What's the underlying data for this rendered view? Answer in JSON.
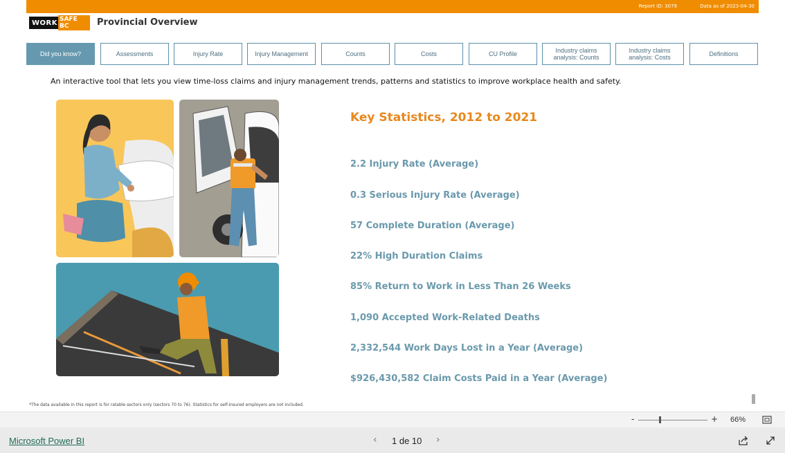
{
  "header": {
    "report_id": "Report ID: 3079",
    "data_as_of": "Data as of 2023-04-30",
    "logo_work": "WORK",
    "logo_safebc": "SAFE BC",
    "title": "Provincial Overview"
  },
  "tabs": [
    {
      "label": "Did you know?",
      "active": true
    },
    {
      "label": "Assessments"
    },
    {
      "label": "Injury Rate"
    },
    {
      "label": "Injury Management"
    },
    {
      "label": "Counts"
    },
    {
      "label": "Costs"
    },
    {
      "label": "CU Profile"
    },
    {
      "label": "Industry claims analysis: Counts"
    },
    {
      "label": "Industry claims analysis: Costs"
    },
    {
      "label": "Definitions"
    }
  ],
  "intro": "An interactive tool that lets you view time-loss claims and injury management trends, patterns and statistics to improve workplace health and safety.",
  "key_stats": {
    "title": "Key Statistics, 2012 to 2021",
    "items": [
      "2.2 Injury Rate (Average)",
      "0.3 Serious Injury Rate (Average)",
      "57 Complete Duration (Average)",
      "22% High Duration Claims",
      "85% Return to Work in Less Than 26 Weeks",
      "1,090 Accepted Work-Related Deaths",
      "2,332,544 Work Days Lost in a Year (Average)",
      "$926,430,582 Claim Costs Paid in a Year (Average)"
    ]
  },
  "footnote": "*The data available in this report is for ratable sectors only (sectors 70 to 76). Statistics for self-insured employers are not included.",
  "zoom": {
    "minus": "-",
    "plus": "+",
    "level": "66%",
    "level_value": 66
  },
  "bottom": {
    "brand": "Microsoft Power BI",
    "page_indicator": "1 de 10",
    "prev": "‹",
    "next": "›"
  },
  "colors": {
    "brand_orange": "#F08C00",
    "tab_active": "#6699AF",
    "stat_text": "#6A99AC",
    "title_orange": "#E8881E"
  }
}
